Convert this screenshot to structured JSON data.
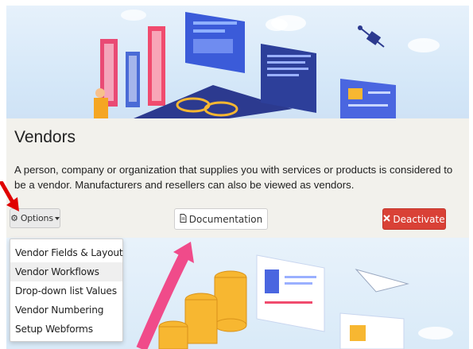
{
  "page": {
    "title": "Vendors",
    "description": "A person, company or organization that supplies you with services or products is considered to be a vendor. Manufacturers and resellers can also be viewed as vendors."
  },
  "buttons": {
    "options_label": "Options",
    "documentation_label": "Documentation",
    "deactivate_label": "Deactivate"
  },
  "dropdown": {
    "items": [
      {
        "label": "Vendor Fields & Layout"
      },
      {
        "label": "Vendor Workflows"
      },
      {
        "label": "Drop-down list Values"
      },
      {
        "label": "Vendor Numbering"
      },
      {
        "label": "Setup Webforms"
      }
    ],
    "highlighted_index": 1
  },
  "icons": {
    "options": "gear-icon",
    "documentation": "file-icon",
    "deactivate": "x-icon",
    "annotation": "red-arrow-icon"
  },
  "colors": {
    "deactivate_bg": "#d94136",
    "panel_bg": "#f2f1ec",
    "annotation_arrow": "#e00000"
  }
}
